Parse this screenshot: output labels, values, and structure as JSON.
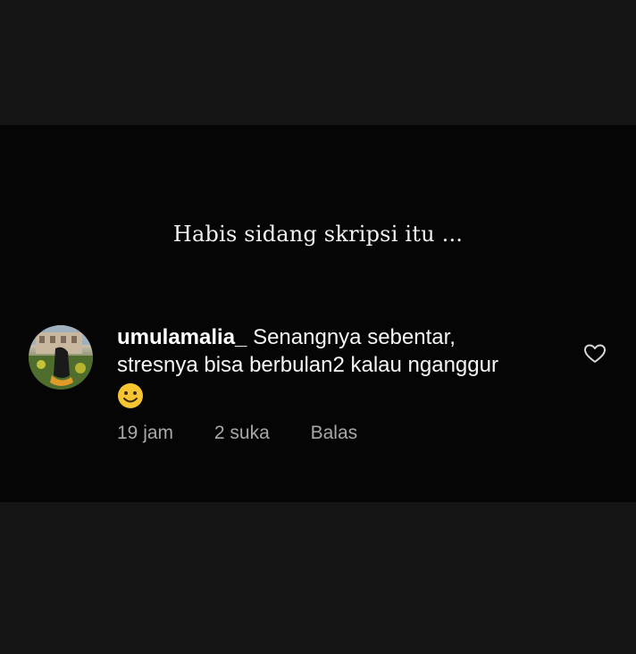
{
  "caption": "Habis sidang skripsi itu ...",
  "comment": {
    "username": "umulamalia_",
    "text_line1": "Senangnya sebentar,",
    "text_line2": "stresnya bisa berbulan2 kalau nganggur",
    "emoji": "slightly-smiling-face",
    "time": "19 jam",
    "likes": "2 suka",
    "reply_label": "Balas"
  },
  "colors": {
    "panel_background": "#050505",
    "outer_background": "#141414",
    "text": "#f5f5f5",
    "meta_text": "#a8a8a8",
    "emoji_yellow": "#f7c531"
  },
  "icons": {
    "like": "heart-outline-icon"
  }
}
